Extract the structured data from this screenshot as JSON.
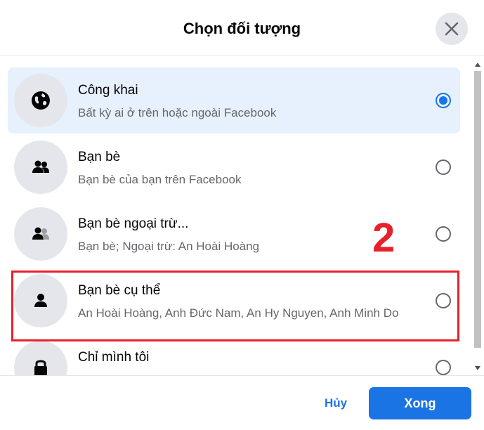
{
  "dialog": {
    "title": "Chọn đối tượng",
    "close_icon": "close-icon"
  },
  "options": [
    {
      "name": "Công khai",
      "description": "Bất kỳ ai ở trên hoặc ngoài Facebook",
      "icon": "globe-icon",
      "selected": true
    },
    {
      "name": "Bạn bè",
      "description": "Bạn bè của bạn trên Facebook",
      "icon": "friends-icon",
      "selected": false
    },
    {
      "name": "Bạn bè ngoại trừ...",
      "description": "Bạn bè; Ngoại trừ: An Hoài Hoàng",
      "icon": "friends-except-icon",
      "selected": false
    },
    {
      "name": "Bạn bè cụ thể",
      "description": "An Hoài Hoàng, Anh Đức Nam, An Hy Nguyen, Anh Minh Do",
      "icon": "person-icon",
      "selected": false
    },
    {
      "name": "Chỉ mình tôi",
      "description": "",
      "icon": "lock-icon",
      "selected": false
    }
  ],
  "annotation": {
    "number": "2",
    "color": "#e8202a"
  },
  "footer": {
    "cancel_label": "Hủy",
    "done_label": "Xong"
  },
  "colors": {
    "accent": "#1b74e4",
    "selected_bg": "#e7f0fd",
    "icon_bg": "#e4e6eb",
    "secondary_text": "#65676b"
  }
}
